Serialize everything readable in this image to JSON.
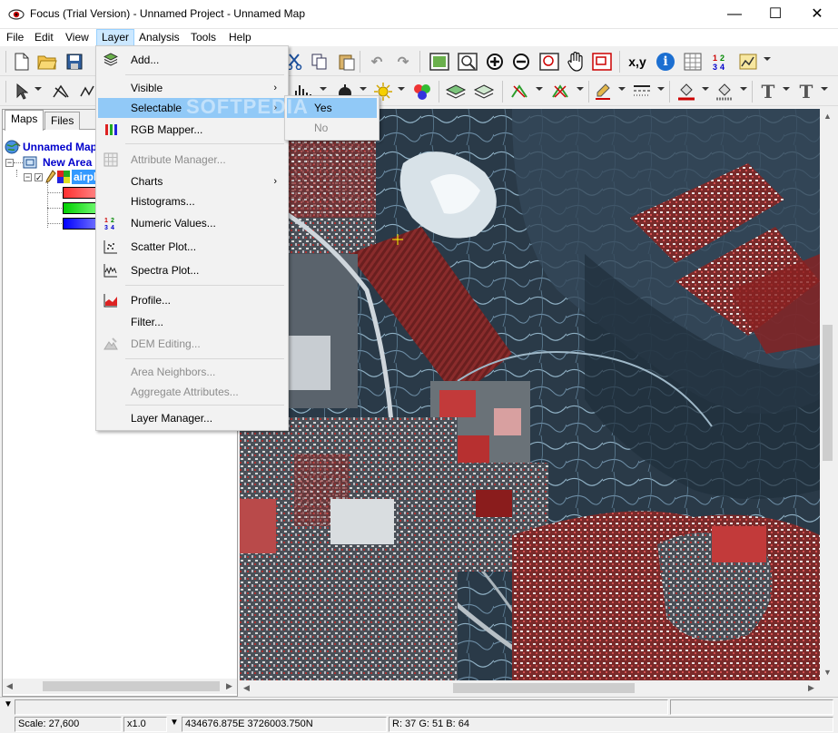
{
  "window": {
    "title": "Focus (Trial Version) - Unnamed Project - Unnamed Map",
    "min_glyph": "—",
    "max_glyph": "☐",
    "close_glyph": "✕"
  },
  "menubar": {
    "items": [
      {
        "label": "File"
      },
      {
        "label": "Edit"
      },
      {
        "label": "View"
      },
      {
        "label": "Layer"
      },
      {
        "label": "Analysis"
      },
      {
        "label": "Tools"
      },
      {
        "label": "Help"
      }
    ],
    "active": "Layer"
  },
  "toolbar1": {
    "icons": [
      "new-file-icon",
      "open-folder-icon",
      "save-icon",
      "cut-icon",
      "copy-icon",
      "paste-icon",
      "undo-icon",
      "redo-icon",
      "zoom-extent-icon",
      "zoom-window-icon",
      "zoom-in-icon",
      "zoom-out-icon",
      "zoom-box-icon",
      "pan-hand-icon",
      "overview-icon",
      "coordinates-icon",
      "info-icon",
      "table-icon",
      "numeric-values-icon",
      "chart-icon"
    ],
    "coord_label": "x,y",
    "info_label": "i",
    "numeric_label": "12 34"
  },
  "toolbar2": {
    "icons": [
      "select-arrow-icon",
      "digitize-icon",
      "line-icon",
      "histogram-icon",
      "contrast-icon",
      "sun-icon",
      "rgb-icon",
      "layer-icon",
      "layer-select-icon",
      "edit-vertex-icon",
      "node-icon",
      "pen-icon",
      "line-style-icon",
      "fill-icon",
      "fill-pattern-icon",
      "text-icon",
      "text-style-icon"
    ],
    "text_glyph": "T"
  },
  "left_panel": {
    "tabs": [
      "Maps",
      "Files"
    ],
    "selected_tab": "Maps",
    "tree": {
      "map": "Unnamed Map",
      "area": "New Area",
      "layer": "airpl",
      "collapse_glyph": "−",
      "checkbox_glyph": "✓"
    },
    "bands": [
      {
        "color": "#ff0000"
      },
      {
        "color": "#00e000"
      },
      {
        "color": "#0000ff"
      }
    ]
  },
  "layer_menu": {
    "items": [
      {
        "label": "Add...",
        "icon": "layers-stack-icon",
        "enabled": true,
        "submenu": false
      },
      {
        "label": "Visible",
        "enabled": true,
        "submenu": true
      },
      {
        "label": "Selectable",
        "enabled": true,
        "submenu": true,
        "highlighted": true
      },
      {
        "label": "RGB Mapper...",
        "icon": "rgb-bars-icon",
        "enabled": true,
        "submenu": false
      },
      {
        "label": "Attribute Manager...",
        "icon": "grid-icon",
        "enabled": false,
        "submenu": false
      },
      {
        "label": "Charts",
        "enabled": true,
        "submenu": true
      },
      {
        "label": "Histograms...",
        "enabled": true,
        "submenu": false
      },
      {
        "label": "Numeric Values...",
        "icon": "numbers-icon",
        "enabled": true,
        "submenu": false
      },
      {
        "label": "Scatter Plot...",
        "icon": "scatter-icon",
        "enabled": true,
        "submenu": false
      },
      {
        "label": "Spectra Plot...",
        "icon": "spectra-icon",
        "enabled": true,
        "submenu": false
      },
      {
        "label": "Profile...",
        "icon": "profile-icon",
        "enabled": true,
        "submenu": false
      },
      {
        "label": "Filter...",
        "enabled": true,
        "submenu": false
      },
      {
        "label": "DEM Editing...",
        "icon": "dem-icon",
        "enabled": false,
        "submenu": false
      },
      {
        "label": "Area Neighbors...",
        "enabled": false,
        "submenu": false
      },
      {
        "label": "Aggregate Attributes...",
        "enabled": false,
        "submenu": false
      },
      {
        "label": "Layer Manager...",
        "enabled": true,
        "submenu": false
      }
    ],
    "submenu_arrow": "›"
  },
  "selectable_submenu": {
    "items": [
      {
        "label": "Yes",
        "highlighted": true,
        "enabled": true
      },
      {
        "label": "No",
        "highlighted": false,
        "enabled": false
      }
    ]
  },
  "watermark": "SOFTPEDIA",
  "status": {
    "scale": "Scale: 27,600",
    "zoom": "x1.0",
    "coords": "434676.875E 3726003.750N",
    "rgb": "R: 37 G: 51 B: 64",
    "collapse_glyph": "▼"
  },
  "colors": {
    "menu_highlight": "#91c9f7",
    "active_menu": "#cce8ff",
    "tree_text": "#0000cc"
  }
}
